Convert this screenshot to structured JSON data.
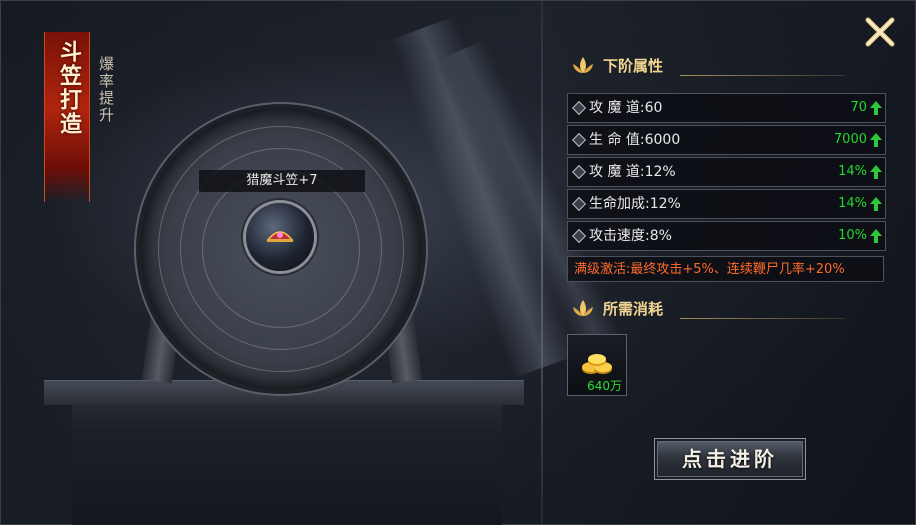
{
  "banner": {
    "title": "斗笠打造",
    "subtitle": "爆率提升"
  },
  "item": {
    "name": "猎魔斗笠+7"
  },
  "next_stage": {
    "title": "下阶属性",
    "stats": [
      {
        "label": "攻 魔 道:60",
        "next": "70"
      },
      {
        "label": "生 命 值:6000",
        "next": "7000"
      },
      {
        "label": "攻 魔 道:12%",
        "next": "14%"
      },
      {
        "label": "生命加成:12%",
        "next": "14%"
      },
      {
        "label": "攻击速度:8%",
        "next": "10%"
      }
    ],
    "bonus": "满级激活:最终攻击+5%、连续鞭尸几率+20%"
  },
  "cost": {
    "title": "所需消耗",
    "amount": "640万",
    "icon": "gold-coins-icon"
  },
  "actions": {
    "advance_label": "点击进阶"
  },
  "colors": {
    "gain": "#23d62d",
    "bonus": "#ff6a2a",
    "section_title": "#f0d590",
    "banner_red": "#b0250f"
  }
}
